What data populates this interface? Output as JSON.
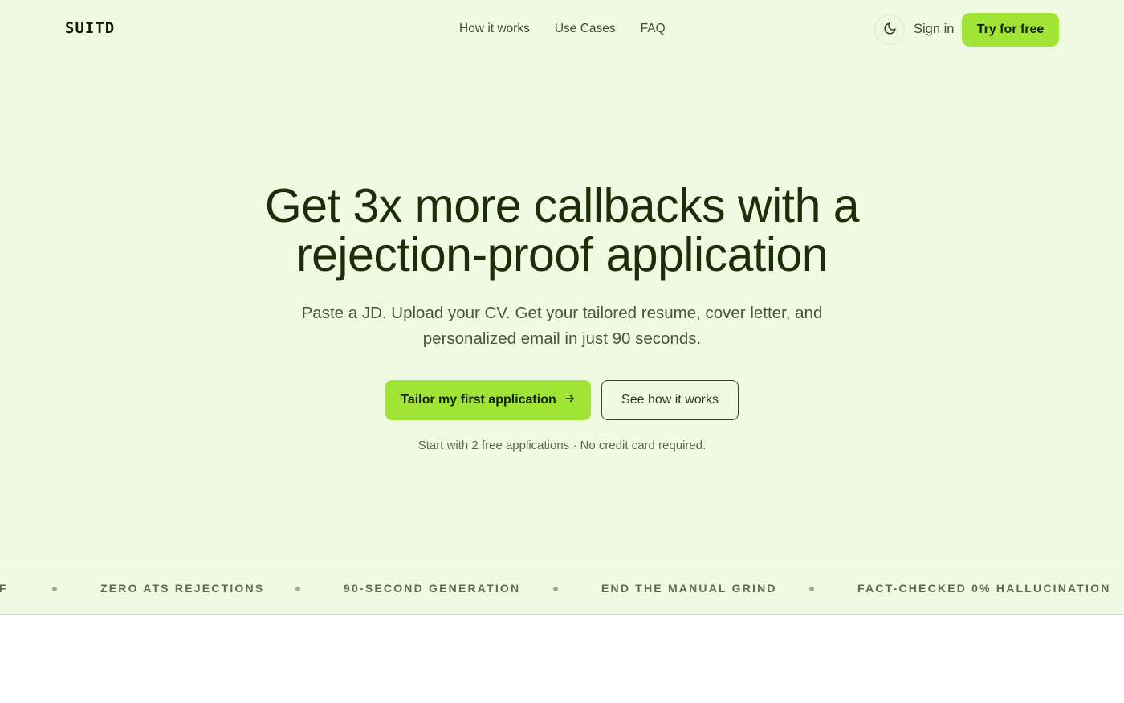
{
  "header": {
    "logo": "SUITD",
    "nav": [
      "How it works",
      "Use Cases",
      "FAQ"
    ],
    "theme_toggle_icon": "moon-icon",
    "signin_label": "Sign in",
    "try_label": "Try for free"
  },
  "hero": {
    "headline_line1": "Get 3x more callbacks with a",
    "headline_line2": "rejection-proof application",
    "subhead_line1": "Paste a JD. Upload your CV. Get your tailored resume, cover letter, and",
    "subhead_line2": "personalized email in just 90 seconds.",
    "cta_primary": "Tailor my first application",
    "cta_primary_icon": "arrow-right-icon",
    "cta_secondary": "See how it works",
    "note": "Start with 2 free applications · No credit card required."
  },
  "marquee": {
    "fragment": "F",
    "items": [
      "ZERO ATS REJECTIONS",
      "90-SECOND GENERATION",
      "END THE MANUAL GRIND",
      "FACT-CHECKED 0% HALLUCINATION"
    ]
  },
  "colors": {
    "hero_background": "#f0fae3",
    "accent": "#a0e535",
    "headline": "#1c2d07"
  }
}
